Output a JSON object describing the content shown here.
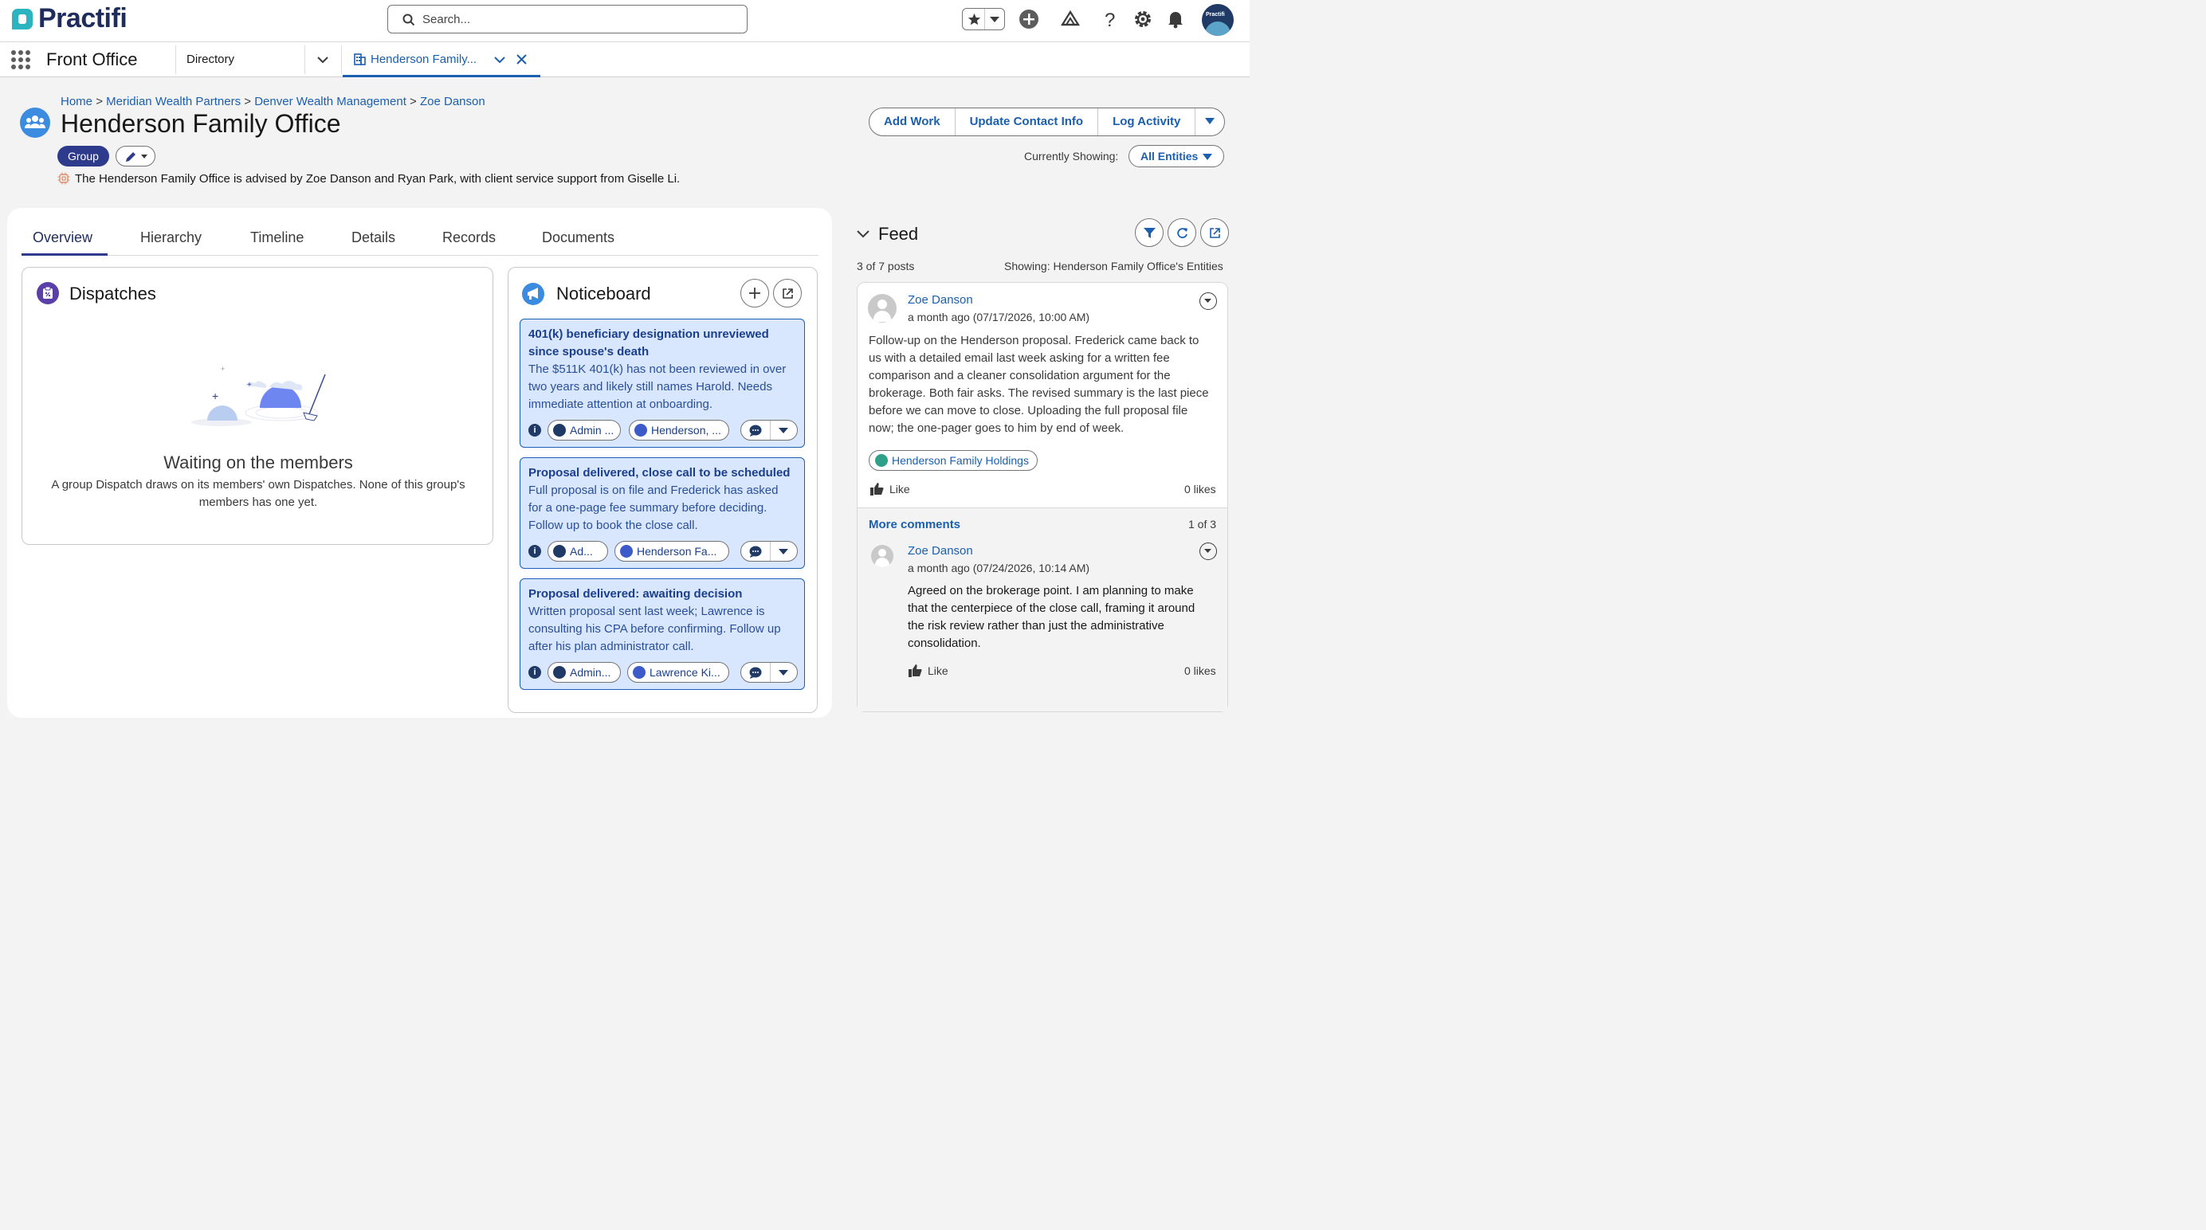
{
  "brand": {
    "name": "Practifi"
  },
  "header": {
    "search_placeholder": "Search...",
    "avatar_text": "Practifi"
  },
  "nav": {
    "app_name": "Front Office",
    "items": [
      {
        "label": "Directory"
      }
    ],
    "active_tab": {
      "label": "Henderson Family..."
    }
  },
  "page": {
    "breadcrumb": [
      {
        "label": "Home"
      },
      {
        "label": "Meridian Wealth Partners"
      },
      {
        "label": "Denver Wealth Management"
      },
      {
        "label": "Zoe Danson"
      }
    ],
    "breadcrumb_sep": ">",
    "title": "Henderson Family Office",
    "type_badge": "Group",
    "description": "The Henderson Family Office is advised by Zoe Danson and Ryan Park, with client service support from Giselle Li.",
    "actions": [
      "Add Work",
      "Update Contact Info",
      "Log Activity"
    ],
    "currently_showing_label": "Currently Showing:",
    "currently_showing_value": "All Entities"
  },
  "tabs": [
    "Overview",
    "Hierarchy",
    "Timeline",
    "Details",
    "Records",
    "Documents"
  ],
  "dispatches": {
    "title": "Dispatches",
    "empty_title": "Waiting on the members",
    "empty_body_line1": "A group Dispatch draws on its members' own Dispatches. None of this group's",
    "empty_body_line2": "members has one yet."
  },
  "noticeboard": {
    "title": "Noticeboard",
    "cards": [
      {
        "title_line1": "401(k) beneficiary designation unreviewed",
        "title_line2": "since spouse's death",
        "body": [
          "The $511K 401(k) has not been reviewed in over",
          "two years and likely still names Harold. Needs",
          "immediate attention at onboarding."
        ],
        "chip1": "Admin ...",
        "chip2": "Henderson, ..."
      },
      {
        "title_line1": "Proposal delivered, close call to be scheduled",
        "body": [
          "Full proposal is on file and Frederick has asked",
          "for a one-page fee summary before deciding.",
          "Follow up to book the close call."
        ],
        "chip1": "Ad...",
        "chip2": "Henderson Fa..."
      },
      {
        "title_line1": "Proposal delivered: awaiting decision",
        "body": [
          "Written proposal sent last week; Lawrence is",
          "consulting his CPA before confirming. Follow up",
          "after his plan administrator call."
        ],
        "chip1": "Admin...",
        "chip2": "Lawrence Ki..."
      }
    ]
  },
  "feed": {
    "title": "Feed",
    "count": "3 of 7 posts",
    "showing": "Showing: Henderson Family Office's Entities",
    "post": {
      "author": "Zoe Danson",
      "time": "a month ago (07/17/2026, 10:00 AM)",
      "body": [
        "Follow-up on the Henderson proposal. Frederick came back to",
        "us with a detailed email last week asking for a written fee",
        "comparison and a cleaner consolidation argument for the",
        "brokerage. Both fair asks. The revised summary is the last piece",
        "before we can move to close. Uploading the full proposal file",
        "now; the one-pager goes to him by end of week."
      ],
      "tag": "Henderson Family Holdings",
      "like_label": "Like",
      "likes": "0 likes"
    },
    "more_comments": "More comments",
    "comments_page": "1 of 3",
    "comment": {
      "author": "Zoe Danson",
      "time": "a month ago (07/24/2026, 10:14 AM)",
      "body": [
        "Agreed on the brokerage point. I am planning to make",
        "that the centerpiece of the close call, framing it around",
        "the risk review rather than just the administrative",
        "consolidation."
      ],
      "like_label": "Like",
      "likes": "0 likes"
    }
  },
  "colors": {
    "brand": "#1f2d5c",
    "link": "#1b5fb0",
    "card": "#d8e6fe",
    "accent": "#2e3a8c"
  }
}
